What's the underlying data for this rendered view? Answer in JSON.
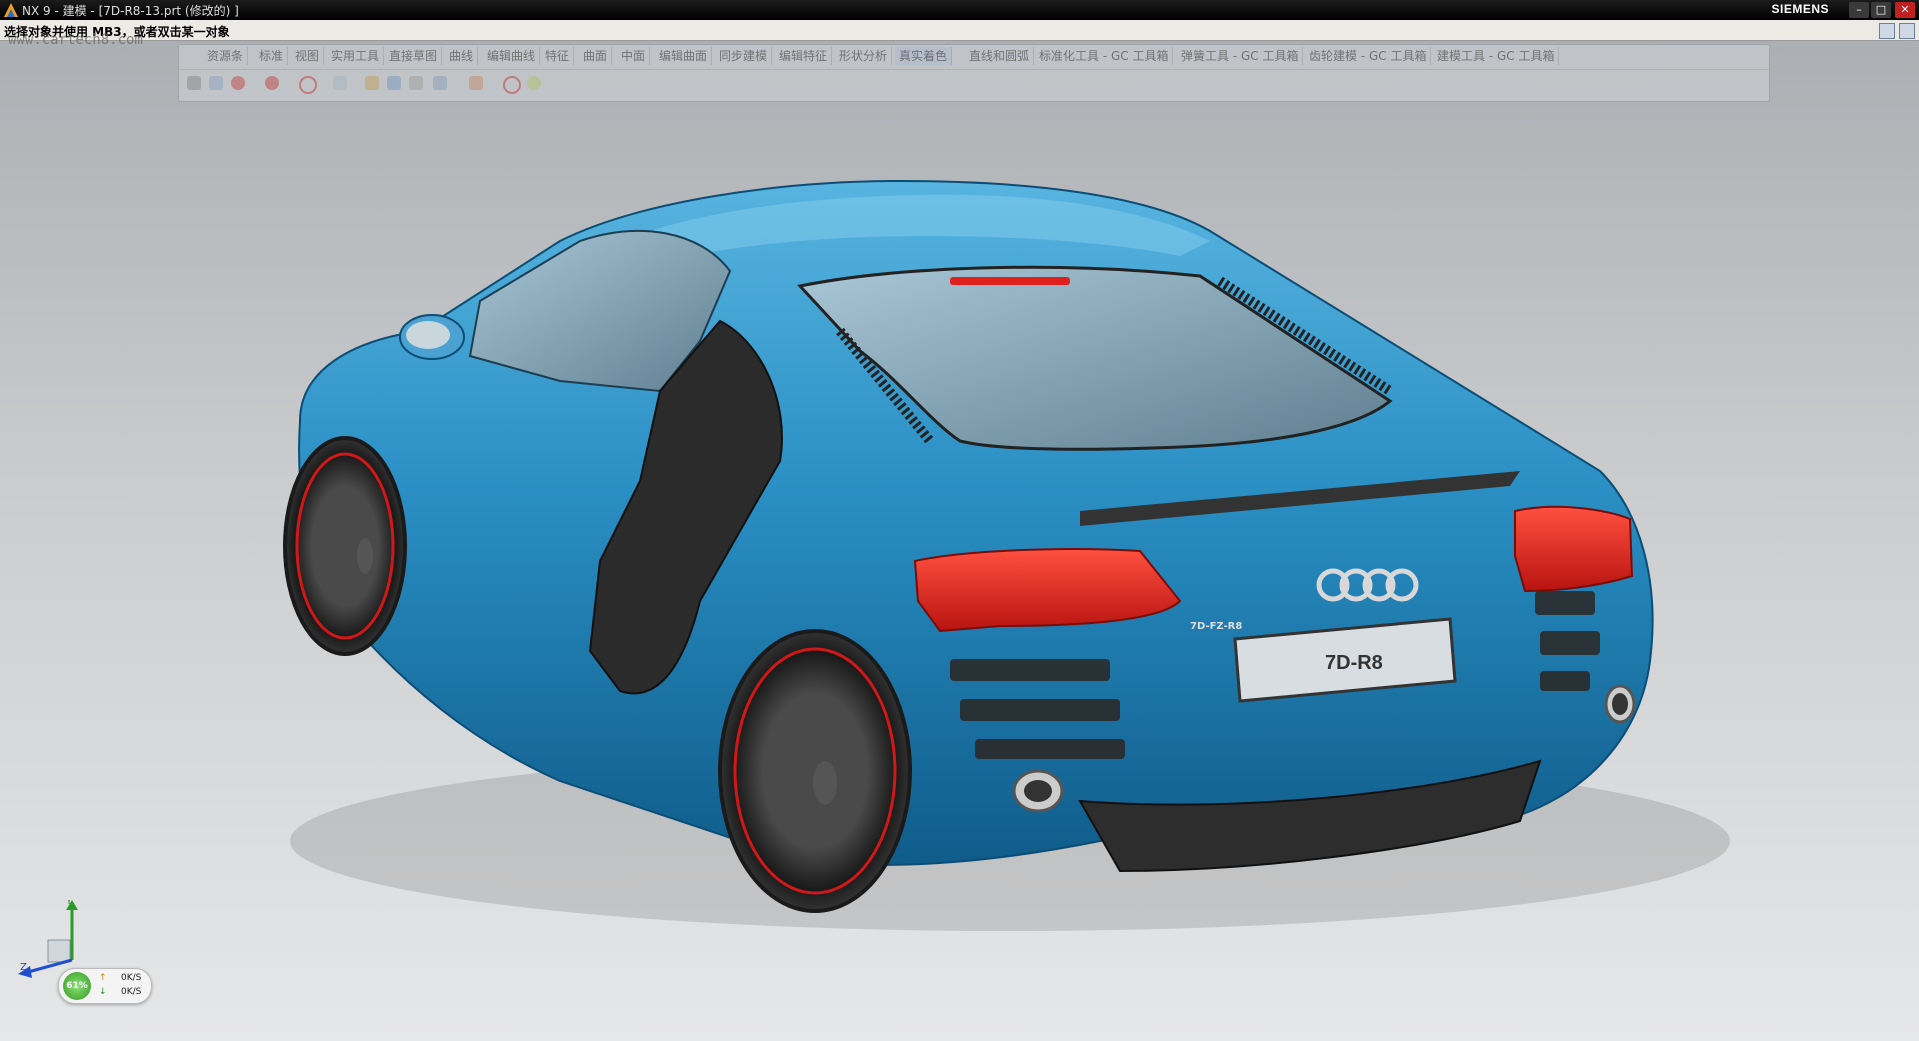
{
  "window": {
    "title": "NX 9 - 建模 - [7D-R8-13.prt  (修改的) ]",
    "brand": "SIEMENS",
    "buttons": {
      "minimize": "–",
      "maximize": "□",
      "close": "✕"
    }
  },
  "status": {
    "prompt": "选择对象并使用 MB3，或者双击某一对象",
    "watermark": "www.cartech8.com"
  },
  "ribbon": {
    "tabs": [
      {
        "label": "资源条"
      },
      {
        "label": "标准"
      },
      {
        "label": "视图"
      },
      {
        "label": "实用工具"
      },
      {
        "label": "直接草图"
      },
      {
        "label": "曲线"
      },
      {
        "label": "编辑曲线"
      },
      {
        "label": "特征"
      },
      {
        "label": "曲面"
      },
      {
        "label": "中面"
      },
      {
        "label": "编辑曲面"
      },
      {
        "label": "同步建模"
      },
      {
        "label": "编辑特征"
      },
      {
        "label": "形状分析"
      },
      {
        "label": "真实着色",
        "active": true
      },
      {
        "label": "直线和圆弧"
      },
      {
        "label": "标准化工具 - GC 工具箱"
      },
      {
        "label": "弹簧工具 - GC 工具箱"
      },
      {
        "label": "齿轮建模 - GC 工具箱"
      },
      {
        "label": "建模工具 - GC 工具箱"
      }
    ]
  },
  "model": {
    "plate": "7D-R8",
    "badge": "7D-FZ-R8",
    "body_color": "#2a8fc4",
    "light_color": "#e0201c"
  },
  "triad": {
    "y": "Y",
    "z": "Z"
  },
  "performance": {
    "gauge": "61%",
    "up_icon": "↑",
    "down_icon": "↓",
    "upload": "0K/S",
    "download": "0K/S"
  }
}
